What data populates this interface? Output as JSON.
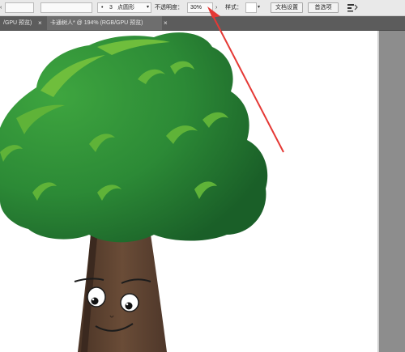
{
  "control_bar": {
    "stroke_points": "3",
    "stroke_profile": "点圆形",
    "opacity_label": "不透明度：",
    "opacity_value": "30%",
    "style_label": "样式：",
    "document_setup_label": "文档设置",
    "preferences_label": "首选项"
  },
  "tabs": [
    {
      "label": "/GPU 预览)",
      "active": false
    },
    {
      "label": "卡通树人* @ 194% (RGB/GPU 预览)",
      "active": true
    }
  ],
  "colors": {
    "annotation_arrow": "#e53935",
    "foliage_dark": "#1e6b2c",
    "foliage_mid": "#2c8a36",
    "foliage_light": "#6fbe3c",
    "trunk": "#5a3f2e",
    "pasteboard": "#8d8d8d"
  },
  "icons": [
    "chevron-left-icon",
    "bullet-dot-icon",
    "chevron-right-icon",
    "style-swatch-icon",
    "chevron-down-icon",
    "arrange-icon",
    "close-icon"
  ]
}
